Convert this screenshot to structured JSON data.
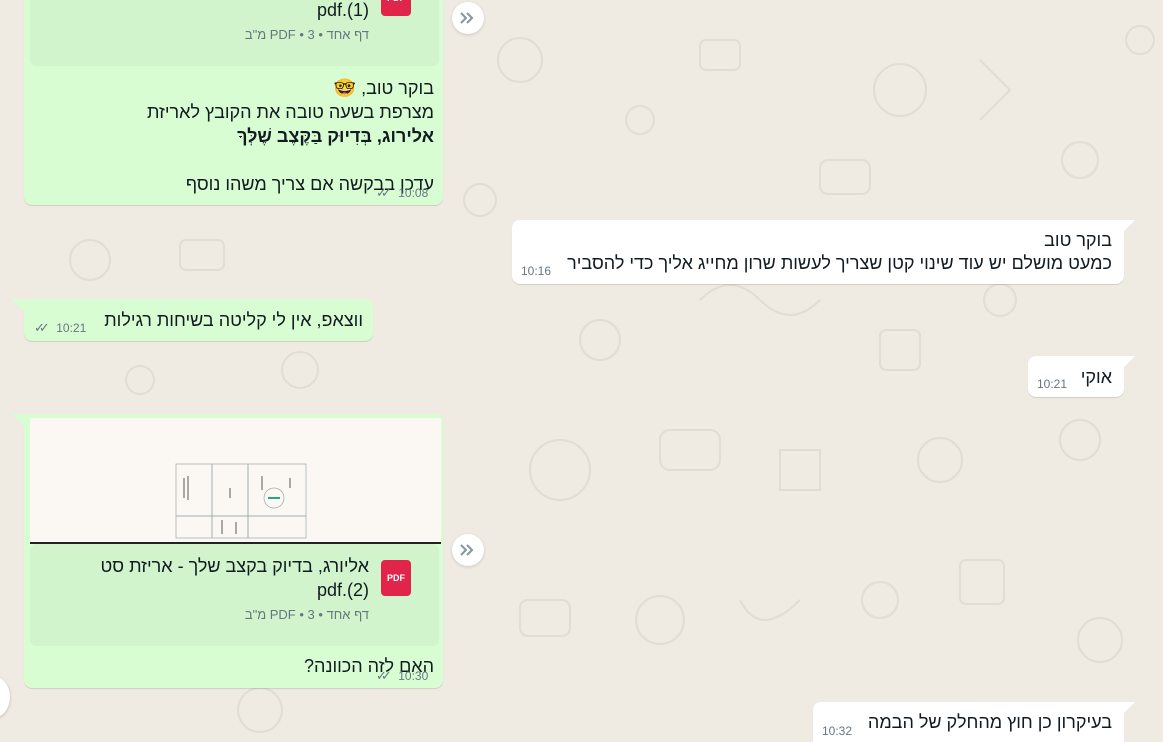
{
  "colors": {
    "background": "#efeae2",
    "outgoing_bubble": "#d9fdd3",
    "incoming_bubble": "#ffffff",
    "pdf_red": "#e0244a",
    "meta_gray": "#667781"
  },
  "messages": [
    {
      "id": "m1",
      "doc": {
        "name_line2": "pdf.(1)",
        "meta": "דף אחד • PDF • 3 מ\"ב",
        "icon": "pdf-icon",
        "icon_label": "PDF"
      },
      "lines": [
        "בוקר טוב, 🤓",
        "מצרפת בשעה טובה את הקובץ לאריזת",
        "אלירוג, בְּדִיוּק בַּקֶּצֶב שֶׁלְּךָ",
        "עדכן בבקשה אם צריך משהו נוסף"
      ],
      "time": "10:08"
    },
    {
      "id": "m2",
      "lines": [
        "בוקר טוב",
        "כמעט מושלם יש עוד שינוי קטן שצריך לעשות שרון מחייג אליך כדי להסביר"
      ],
      "time": "10:16"
    },
    {
      "id": "m3",
      "lines": [
        "ווצאפ, אין לי קליטה בשיחות רגילות"
      ],
      "time": "10:21"
    },
    {
      "id": "m4",
      "lines": [
        "אוקי"
      ],
      "time": "10:21"
    },
    {
      "id": "m5",
      "doc": {
        "name_line1": "אליורג, בדיוק בקצב שלך - אריזת סט",
        "name_line2": "pdf.(2)",
        "meta": "דף אחד • PDF • 3 מ\"ב",
        "icon": "pdf-icon",
        "icon_label": "PDF"
      },
      "lines": [
        "האם לזה הכוונה?"
      ],
      "time": "10:30"
    },
    {
      "id": "m6",
      "lines": [
        "בעיקרון כן חוץ מהחלק של הבמה"
      ],
      "time": "10:32"
    }
  ],
  "icons": {
    "forward": "forward-icon",
    "read_receipt": "double-check-icon"
  }
}
